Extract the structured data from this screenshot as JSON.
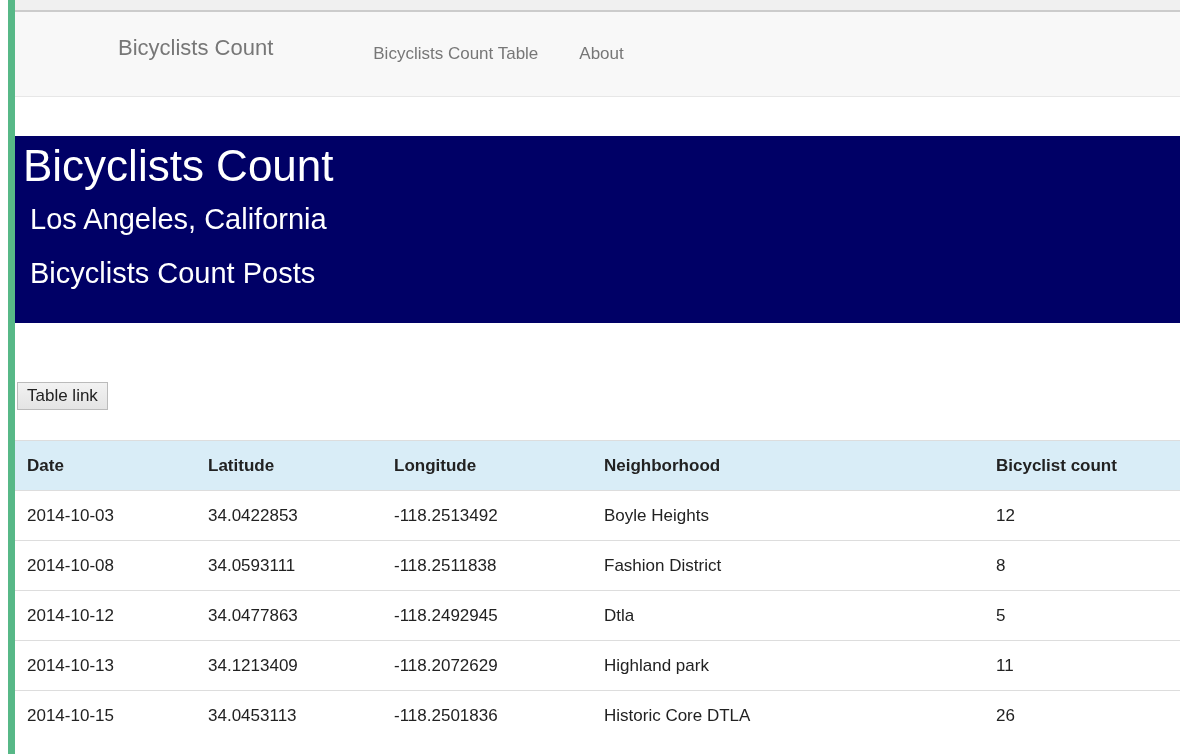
{
  "navbar": {
    "brand": "Bicyclists Count",
    "links": [
      "Bicyclists Count Table",
      "About"
    ]
  },
  "banner": {
    "title": "Bicyclists Count",
    "subtitles": [
      "Los Angeles, California",
      "Bicyclists Count Posts"
    ]
  },
  "button": "Table link",
  "table": {
    "columns": [
      "Date",
      "Latitude",
      "Longitude",
      "Neighborhood",
      "Bicyclist count"
    ],
    "rows": [
      [
        "2014-10-03",
        "34.0422853",
        "-118.2513492",
        "Boyle Heights",
        "12"
      ],
      [
        "2014-10-08",
        "34.0593111",
        "-118.2511838",
        "Fashion District",
        "8"
      ],
      [
        "2014-10-12",
        "34.0477863",
        "-118.2492945",
        "Dtla",
        "5"
      ],
      [
        "2014-10-13",
        "34.1213409",
        "-118.2072629",
        "Highland park",
        "11"
      ],
      [
        "2014-10-15",
        "34.0453113",
        "-118.2501836",
        "Historic Core DTLA",
        "26"
      ]
    ]
  }
}
